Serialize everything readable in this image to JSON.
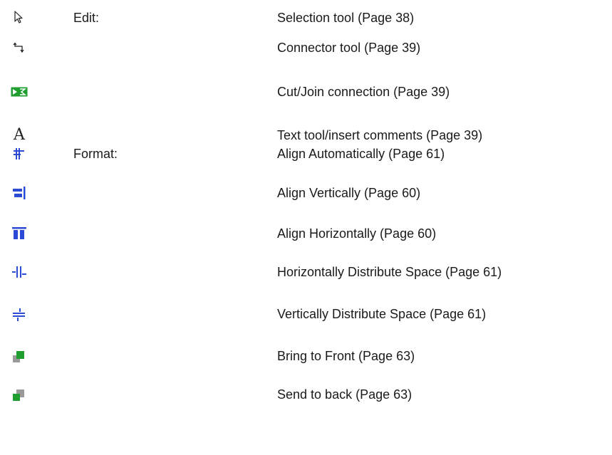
{
  "items": [
    {
      "icon": "selection-arrow-icon",
      "category": "Edit:",
      "description": "Selection tool (Page 38)"
    },
    {
      "icon": "connector-tool-icon",
      "category": "",
      "description": "Connector tool (Page 39)"
    },
    {
      "icon": "cut-join-connection-icon",
      "category": "",
      "description": "Cut/Join connection (Page 39)"
    },
    {
      "icon": "text-tool-icon",
      "category": "",
      "description": "Text tool/insert comments (Page 39)"
    },
    {
      "icon": "align-automatically-icon",
      "category": "Format:",
      "description": "Align Automatically (Page 61)"
    },
    {
      "icon": "align-vertically-icon",
      "category": "",
      "description": "Align Vertically (Page 60)"
    },
    {
      "icon": "align-horizontally-icon",
      "category": "",
      "description": "Align Horizontally (Page 60)"
    },
    {
      "icon": "horizontal-distribute-icon",
      "category": "",
      "description": "Horizontally Distribute Space (Page 61)"
    },
    {
      "icon": "vertical-distribute-icon",
      "category": "",
      "description": "Vertically Distribute Space (Page 61)"
    },
    {
      "icon": "bring-to-front-icon",
      "category": "",
      "description": "Bring to Front (Page 63)"
    },
    {
      "icon": "send-to-back-icon",
      "category": "",
      "description": "Send to back (Page 63)"
    }
  ],
  "colors": {
    "blue": "#2b4bd6",
    "green": "#1e9e2e",
    "gray": "#9a9a9a",
    "text": "#1a1a1a"
  }
}
